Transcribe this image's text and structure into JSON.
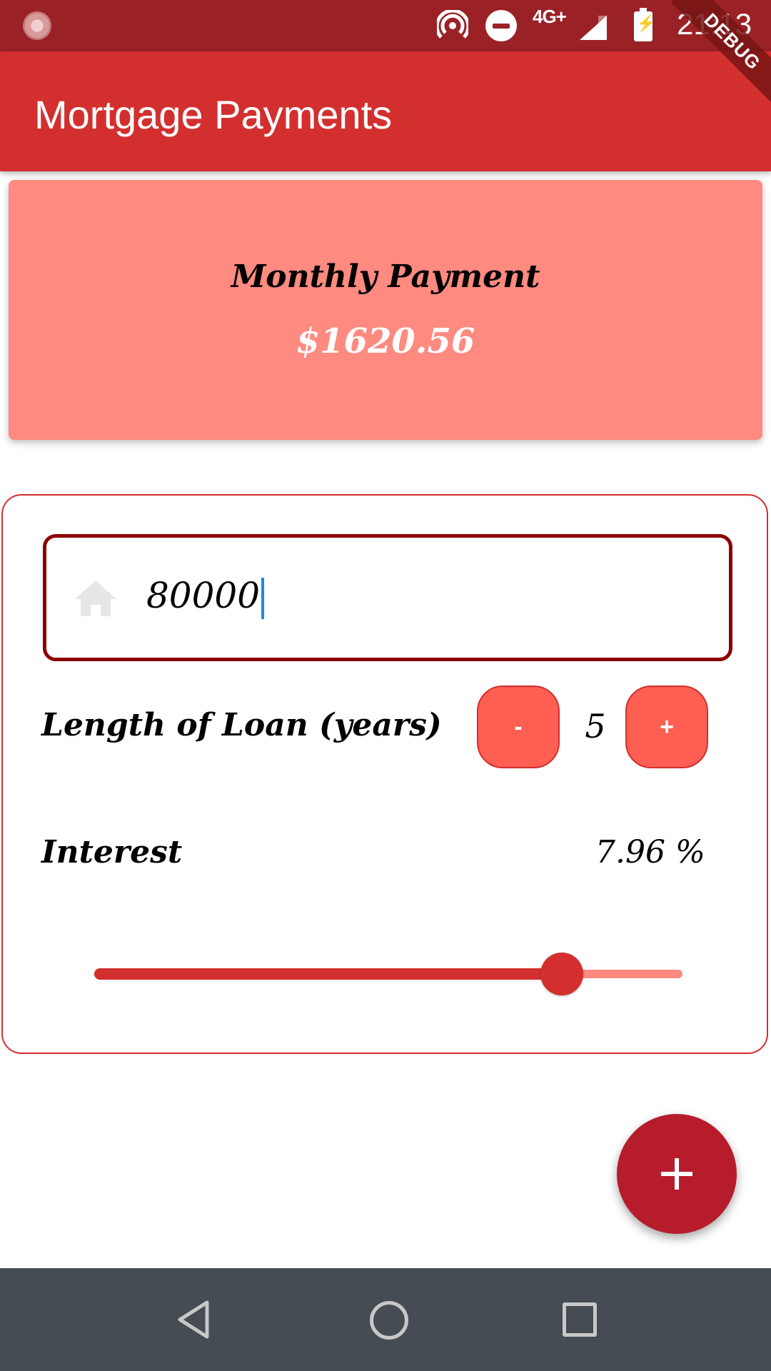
{
  "status_bar": {
    "network": "4G+",
    "time": "21:13",
    "debug_banner": "DEBUG"
  },
  "app_bar": {
    "title": "Mortgage Payments"
  },
  "result": {
    "label": "Monthly Payment",
    "value": "$1620.56"
  },
  "form": {
    "amount": {
      "value": "80000",
      "icon": "home-icon"
    },
    "loan_length": {
      "label": "Length of Loan  (years)",
      "minus_label": "-",
      "plus_label": "+",
      "value": "5"
    },
    "interest": {
      "label": "Interest",
      "value_text": "7.96 %",
      "slider_fraction": 0.795
    }
  },
  "fab": {
    "icon": "plus-icon"
  },
  "colors": {
    "status_bar": "#9a2226",
    "app_bar": "#d32f2f",
    "result_card": "#ff8a80",
    "field_border": "#8b0000",
    "button": "#ff5f52",
    "fab": "#b71c2c",
    "nav_bar": "#454c53"
  }
}
